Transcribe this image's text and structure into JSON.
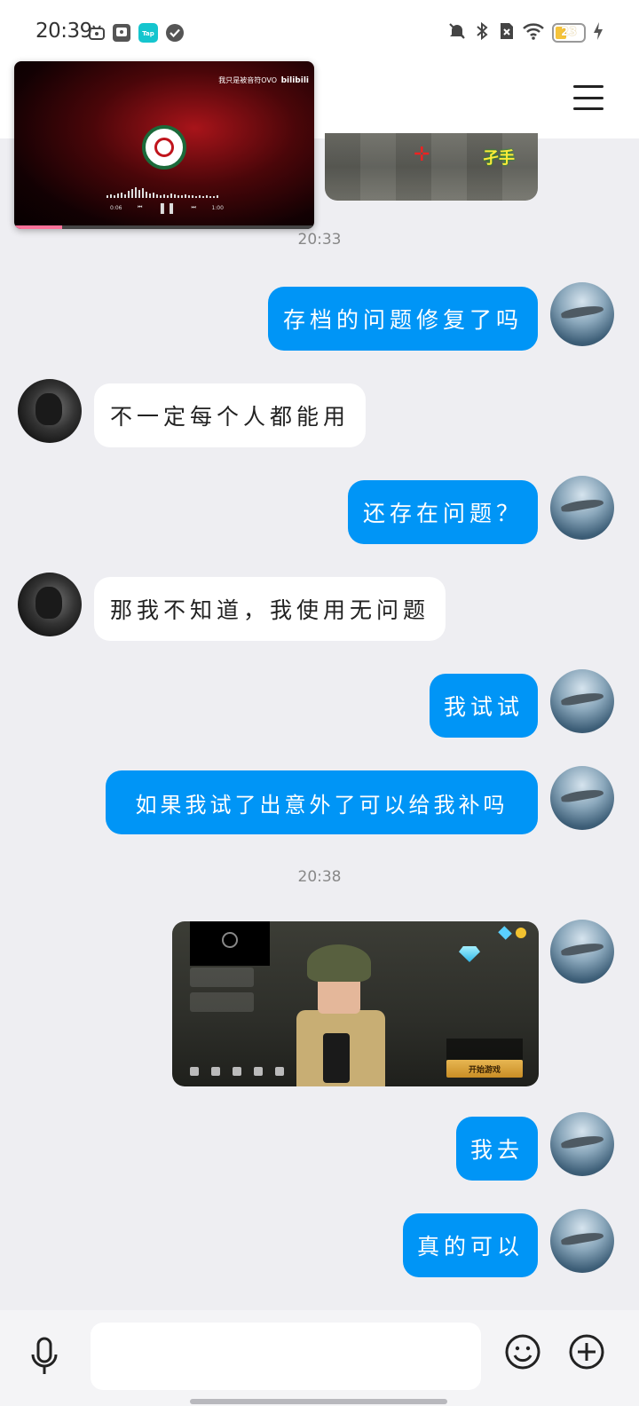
{
  "status_bar": {
    "time": "20:39",
    "battery": "23",
    "left_icons": [
      "app-icon",
      "gallery-icon",
      "taptap-icon",
      "check-icon"
    ],
    "right_icons": [
      "mute-icon",
      "bluetooth-icon",
      "no-sim-icon",
      "wifi-icon",
      "battery-icon",
      "charging-icon"
    ]
  },
  "header": {
    "menu_icon": "hamburger-icon"
  },
  "floating_video": {
    "caption": "我只是被音符OVO",
    "brand": "bilibili",
    "time_current": "0:06",
    "time_total": "1:00",
    "progress": 0.16
  },
  "partial_image": {
    "overlay_text": "孑手"
  },
  "messages": [
    {
      "type": "timestamp",
      "text": "20:33"
    },
    {
      "type": "text",
      "from": "me",
      "text": "存档的问题修复了吗"
    },
    {
      "type": "text",
      "from": "other",
      "text": "不一定每个人都能用"
    },
    {
      "type": "text",
      "from": "me",
      "text": "还存在问题？"
    },
    {
      "type": "text",
      "from": "other",
      "text": "那我不知道，我使用无问题"
    },
    {
      "type": "text",
      "from": "me",
      "text": "我试试"
    },
    {
      "type": "text",
      "from": "me",
      "text": "如果我试了出意外了可以给我补吗"
    },
    {
      "type": "timestamp",
      "text": "20:38"
    },
    {
      "type": "image",
      "from": "me",
      "start_label": "开始游戏"
    },
    {
      "type": "text",
      "from": "me",
      "text": "我去"
    },
    {
      "type": "text",
      "from": "me",
      "text": "真的可以"
    }
  ],
  "input_bar": {
    "placeholder": "",
    "icons": [
      "microphone-icon",
      "emoji-icon",
      "plus-icon"
    ]
  }
}
